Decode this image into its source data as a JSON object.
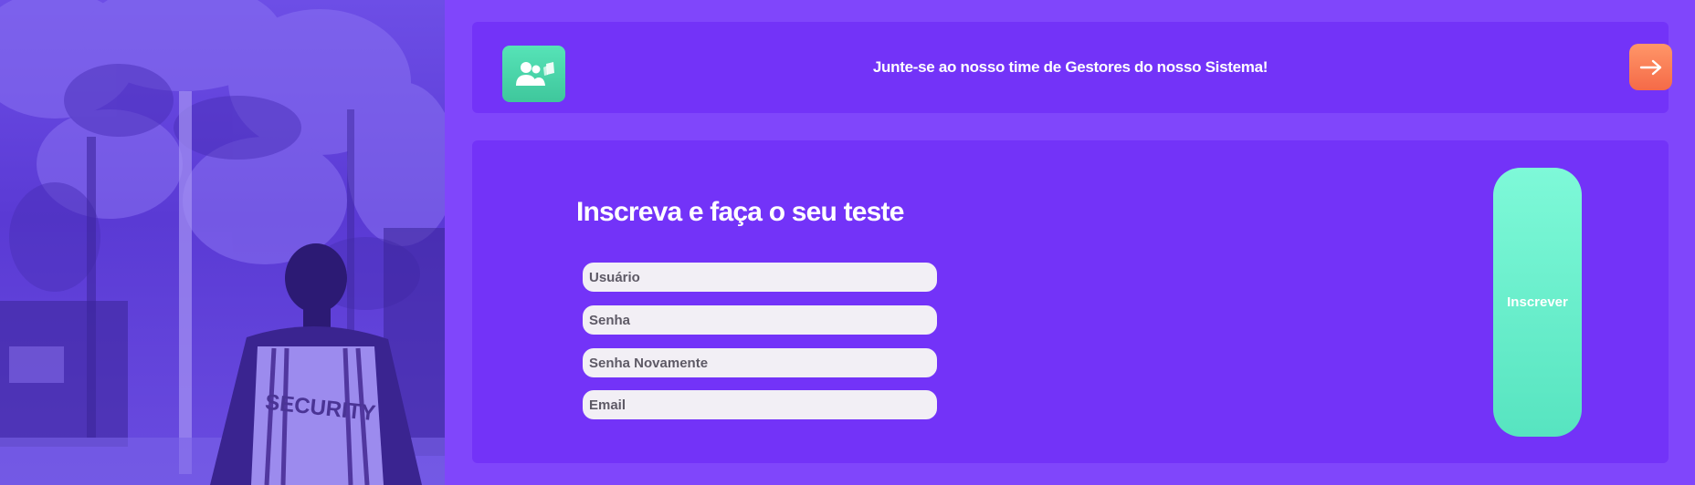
{
  "hero": {
    "vest_text": "SECURITY"
  },
  "banner": {
    "icon": "team-users-icon",
    "text": "Junte-se ao nosso time de Gestores do nosso Sistema!",
    "arrow_icon": "arrow-right-icon"
  },
  "form": {
    "title": "Inscreva e faça o seu teste",
    "fields": [
      {
        "placeholder": "Usuário",
        "value": ""
      },
      {
        "placeholder": "Senha",
        "value": ""
      },
      {
        "placeholder": "Senha Novamente",
        "value": ""
      },
      {
        "placeholder": "Email",
        "value": ""
      }
    ],
    "submit_label": "Inscrever"
  },
  "colors": {
    "page_bg": "#8046fb",
    "panel_bg": "#7333f8",
    "accent_green": "#57e4c0",
    "accent_orange": "#f56a48"
  }
}
